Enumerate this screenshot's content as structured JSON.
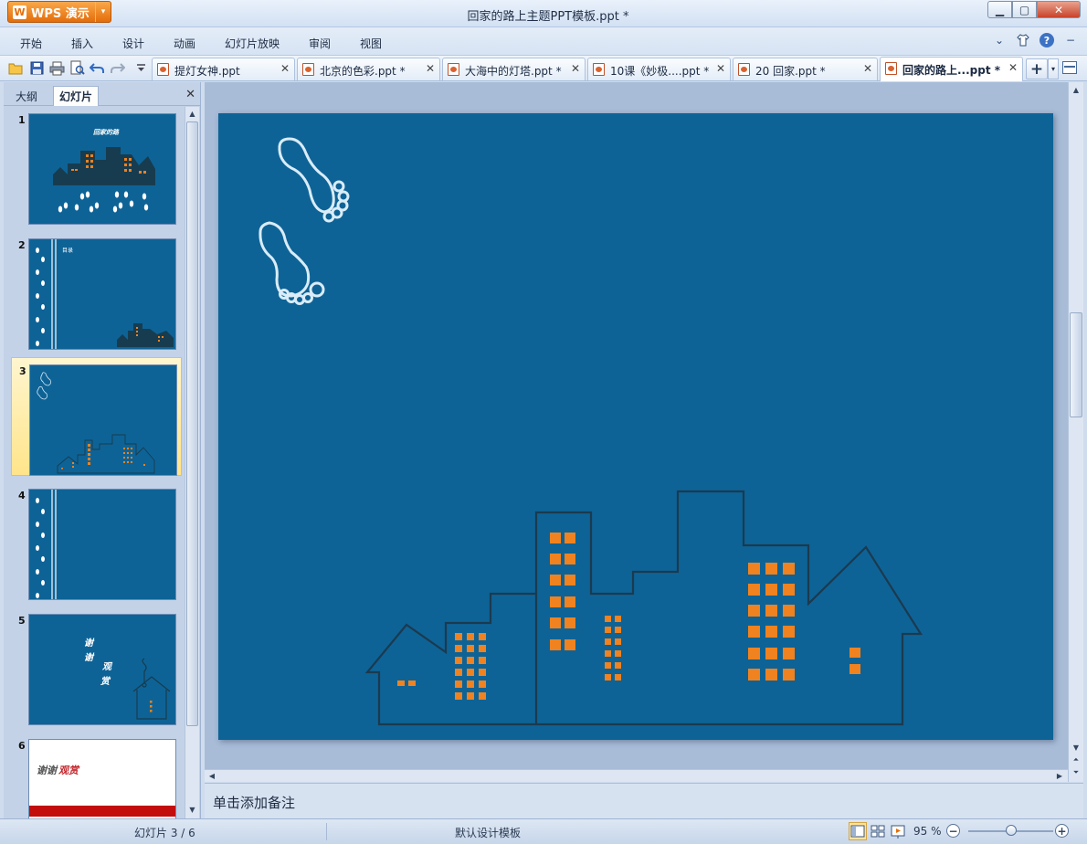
{
  "app": {
    "button_label": "WPS 演示",
    "window_title": "回家的路上主题PPT模板.ppt *"
  },
  "menu": {
    "items": [
      "开始",
      "插入",
      "设计",
      "动画",
      "幻灯片放映",
      "审阅",
      "视图"
    ]
  },
  "tabs": [
    {
      "label": "提灯女神.ppt",
      "active": false
    },
    {
      "label": "北京的色彩.ppt *",
      "active": false
    },
    {
      "label": "大海中的灯塔.ppt *",
      "active": false
    },
    {
      "label": "10课《妙极....ppt *",
      "active": false
    },
    {
      "label": "20 回家.ppt *",
      "active": false
    },
    {
      "label": "回家的路上...ppt *",
      "active": true
    }
  ],
  "left_panel": {
    "tabs": [
      "大纲",
      "幻灯片"
    ],
    "active_tab": "幻灯片",
    "slides": [
      {
        "number": "1",
        "title_text": "回家的路"
      },
      {
        "number": "2",
        "title_text": "目录"
      },
      {
        "number": "3",
        "selected": true
      },
      {
        "number": "4"
      },
      {
        "number": "5",
        "text_lines": [
          "谢",
          "谢",
          "观",
          "赏"
        ]
      },
      {
        "number": "6",
        "text_plain": "谢谢",
        "text_red": "观赏"
      }
    ]
  },
  "notes": {
    "placeholder": "单击添加备注"
  },
  "status": {
    "slide_info": "幻灯片 3 / 6",
    "template": "默认设计模板",
    "zoom": "95 %",
    "zoom_level": 0.5
  },
  "colors": {
    "slide_background": "#0e6396",
    "window_accent": "#f08a24",
    "building_outline": "#1b3a4f",
    "windows_orange": "#f0821f",
    "footprint_stroke": "#d9ecf7"
  },
  "icons": {
    "quick_access": [
      "open-icon",
      "save-icon",
      "print-icon",
      "print-preview-icon",
      "undo-icon",
      "redo-icon",
      "customize-icon"
    ],
    "menu_right": [
      "chevron-down-icon",
      "skin-icon",
      "help-icon",
      "minimize-icon"
    ],
    "views": [
      "normal-view-icon",
      "slide-sorter-icon",
      "slideshow-icon"
    ]
  }
}
